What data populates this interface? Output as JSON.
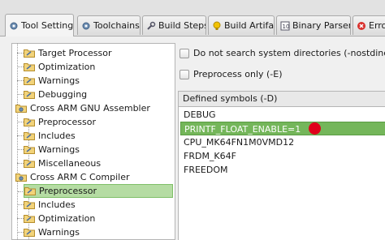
{
  "tabs": [
    {
      "label": "Tool Settings",
      "icon": "gear-icon",
      "active": true
    },
    {
      "label": "Toolchains",
      "icon": "gear-icon"
    },
    {
      "label": "Build Steps",
      "icon": "wrench-icon"
    },
    {
      "label": "Build Artifact",
      "icon": "artifact-icon"
    },
    {
      "label": "Binary Parsers",
      "icon": "binary-icon"
    },
    {
      "label": "Error",
      "icon": "error-icon"
    }
  ],
  "tree": [
    {
      "label": "Target Processor",
      "level": 1
    },
    {
      "label": "Optimization",
      "level": 1
    },
    {
      "label": "Warnings",
      "level": 1
    },
    {
      "label": "Debugging",
      "level": 1
    },
    {
      "label": "Cross ARM GNU Assembler",
      "level": 0,
      "type": "tool"
    },
    {
      "label": "Preprocessor",
      "level": 1
    },
    {
      "label": "Includes",
      "level": 1
    },
    {
      "label": "Warnings",
      "level": 1
    },
    {
      "label": "Miscellaneous",
      "level": 1
    },
    {
      "label": "Cross ARM C Compiler",
      "level": 0,
      "type": "tool"
    },
    {
      "label": "Preprocessor",
      "level": 1,
      "selected": true
    },
    {
      "label": "Includes",
      "level": 1
    },
    {
      "label": "Optimization",
      "level": 1
    },
    {
      "label": "Warnings",
      "level": 1
    }
  ],
  "options": {
    "nostdinc_label": "Do not search system directories (-nostdinc)",
    "preprocess_only_label": "Preprocess only (-E)"
  },
  "symbols": {
    "header": "Defined symbols (-D)",
    "items": [
      "DEBUG",
      "PRINTF_FLOAT_ENABLE=1",
      "CPU_MK64FN1M0VMD12",
      "FRDM_K64F",
      "FREEDOM"
    ],
    "selected_index": 1
  },
  "colors": {
    "selection": "#74b65a",
    "marker": "#e0001b"
  }
}
